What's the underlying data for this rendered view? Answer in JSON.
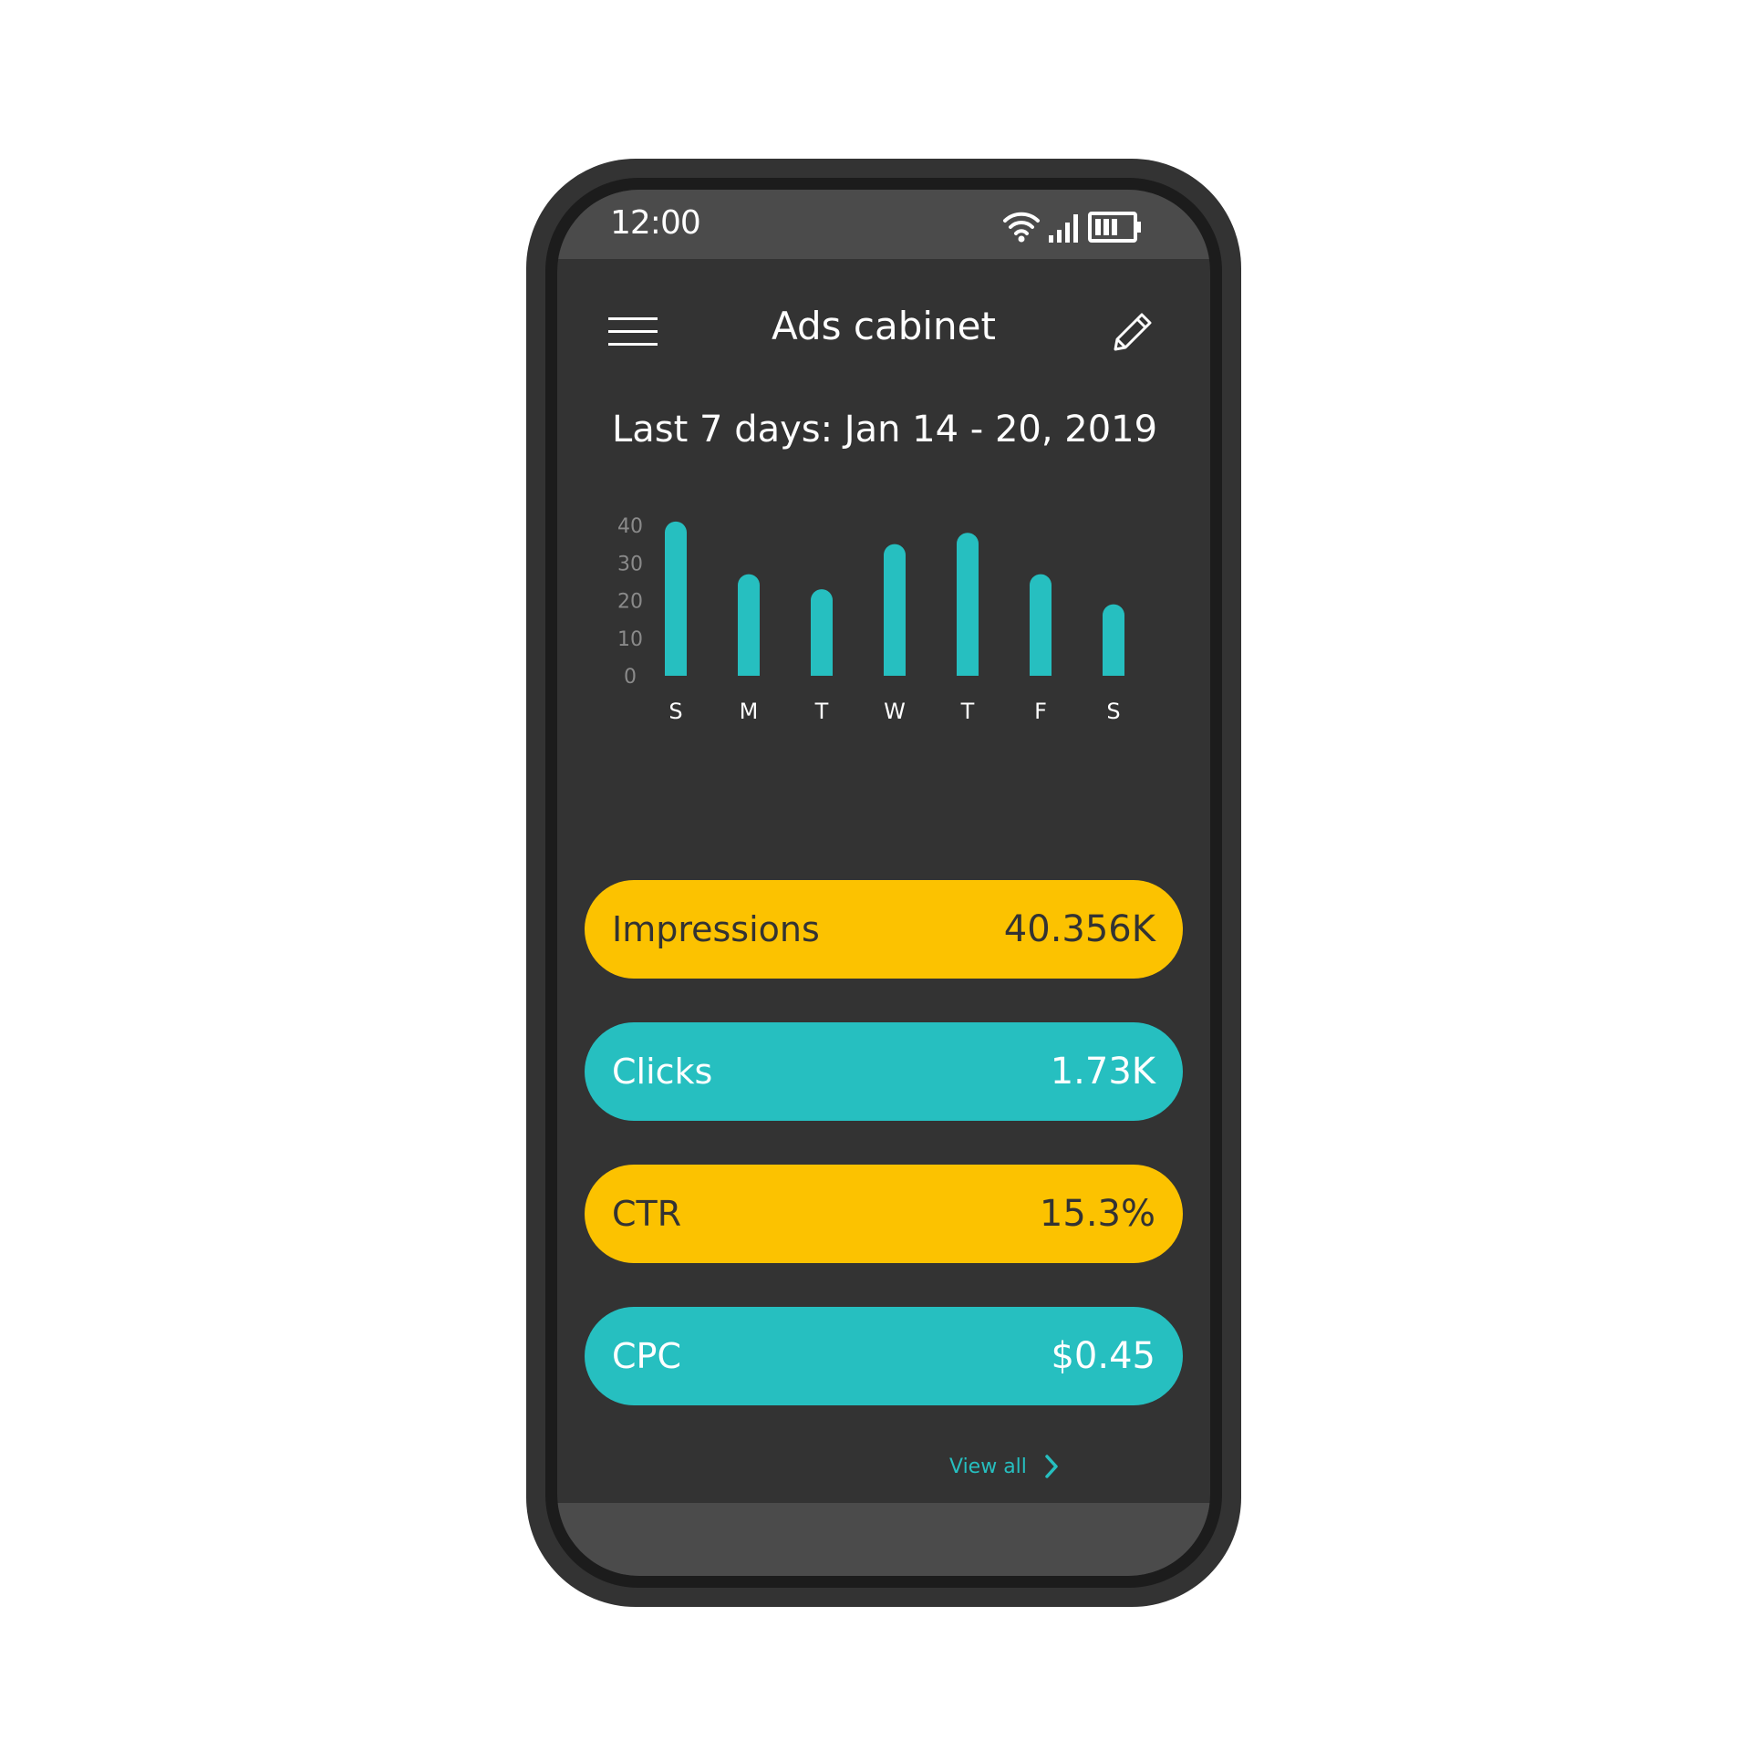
{
  "status_bar": {
    "time": "12:00",
    "icons": [
      "wifi-icon",
      "signal-icon",
      "battery-icon"
    ]
  },
  "header": {
    "title": "Ads cabinet",
    "menu_icon": "menu-icon",
    "edit_icon": "pencil-icon"
  },
  "date_range": "Last 7 days: Jan 14 - 20, 2019",
  "chart_data": {
    "type": "bar",
    "categories": [
      "S",
      "M",
      "T",
      "W",
      "T",
      "F",
      "S"
    ],
    "values": [
      41,
      27,
      23,
      35,
      38,
      27,
      19
    ],
    "yticks": [
      "40",
      "30",
      "20",
      "10",
      "0"
    ],
    "ylim": [
      0,
      40
    ],
    "title": "",
    "xlabel": "",
    "ylabel": "",
    "grid": false,
    "bar_color": "#26bfc0"
  },
  "metrics": [
    {
      "label": "Impressions",
      "value": "40.356K",
      "color": "#fcc200",
      "text_color": "#333333"
    },
    {
      "label": "Clicks",
      "value": "1.73K",
      "color": "#26bfc0",
      "text_color": "#ffffff"
    },
    {
      "label": "CTR",
      "value": "15.3%",
      "color": "#fcc200",
      "text_color": "#333333"
    },
    {
      "label": "CPC",
      "value": "$0.45",
      "color": "#26bfc0",
      "text_color": "#ffffff"
    }
  ],
  "view_all": {
    "label": "View all",
    "icon": "chevron-right-icon"
  },
  "colors": {
    "accent_teal": "#26bfc0",
    "accent_yellow": "#fcc200",
    "screen_bg": "#333333",
    "bar_bg": "#4b4b4b"
  }
}
